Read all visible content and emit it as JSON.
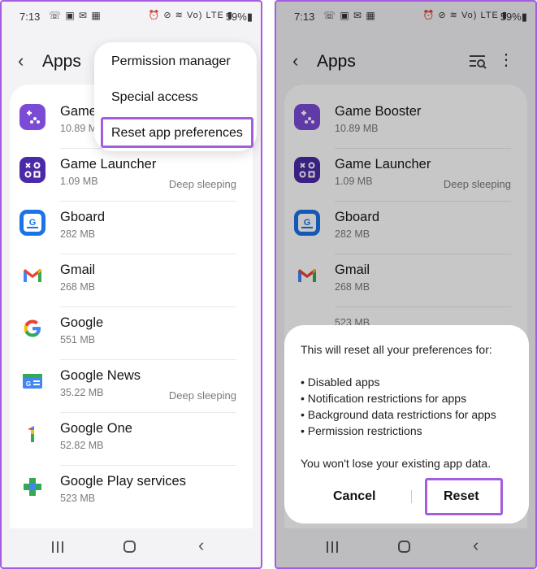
{
  "status_bar": {
    "time": "7:13",
    "left_icons": "☏ ▣ ✉ ▦",
    "right_icons": "⏰ ⊘ ≋ Vo) LTE ▮",
    "battery": "59%▮"
  },
  "app_bar": {
    "title": "Apps"
  },
  "menu": {
    "items": [
      "Permission manager",
      "Special access",
      "Reset app preferences"
    ]
  },
  "left_apps": [
    {
      "name": "Game",
      "size": "10.89 M",
      "status": "",
      "icon": "game-booster-icon",
      "color": "#7b4bd6"
    },
    {
      "name": "Game Launcher",
      "size": "1.09 MB",
      "status": "Deep sleeping",
      "icon": "game-launcher-icon",
      "color": "#4a2aa6"
    },
    {
      "name": "Gboard",
      "size": "282 MB",
      "status": "",
      "icon": "gboard-icon",
      "color": "#1a73e8"
    },
    {
      "name": "Gmail",
      "size": "268 MB",
      "status": "",
      "icon": "gmail-icon",
      "color": "#ea4335"
    },
    {
      "name": "Google",
      "size": "551 MB",
      "status": "",
      "icon": "google-icon",
      "color": "#4285f4"
    },
    {
      "name": "Google News",
      "size": "35.22 MB",
      "status": "Deep sleeping",
      "icon": "google-news-icon",
      "color": "#1a73e8"
    },
    {
      "name": "Google One",
      "size": "52.82 MB",
      "status": "",
      "icon": "google-one-icon",
      "color": "#34a853"
    },
    {
      "name": "Google Play services",
      "size": "523 MB",
      "status": "",
      "icon": "google-play-services-icon",
      "color": "#34a853"
    }
  ],
  "right_apps": [
    {
      "name": "Game Booster",
      "size": "10.89 MB",
      "status": "",
      "icon": "game-booster-icon"
    },
    {
      "name": "Game Launcher",
      "size": "1.09 MB",
      "status": "Deep sleeping",
      "icon": "game-launcher-icon"
    },
    {
      "name": "Gboard",
      "size": "282 MB",
      "status": "",
      "icon": "gboard-icon"
    },
    {
      "name": "Gmail",
      "size": "268 MB",
      "status": "",
      "icon": "gmail-icon"
    },
    {
      "name": "",
      "size": "523 MB",
      "status": "",
      "icon": ""
    }
  ],
  "dialog": {
    "message": "This will reset all your preferences for:",
    "bullets": [
      "• Disabled apps",
      "• Notification restrictions for apps",
      "• Background data restrictions for apps",
      "• Permission restrictions"
    ],
    "note": "You won't lose your existing app data.",
    "cancel_label": "Cancel",
    "reset_label": "Reset"
  },
  "icon_glyphs": {
    "back": "‹",
    "nav_back": "‹",
    "more": "⋮"
  },
  "accent_color": "#a55ce0"
}
